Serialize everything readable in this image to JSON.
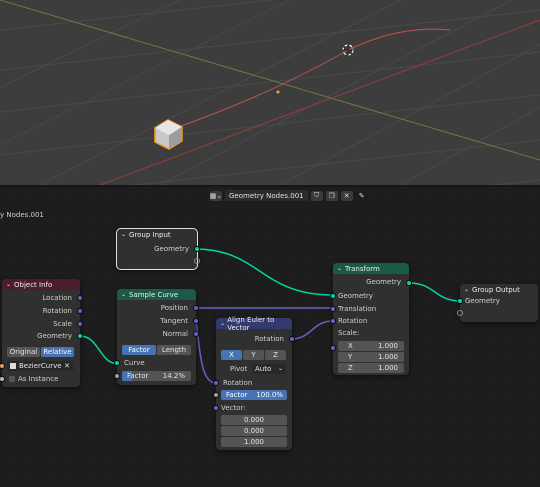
{
  "editor": {
    "tree_name": "Geometry Nodes.001",
    "breadcrumb": "y Nodes.001"
  },
  "nodes": {
    "group_input": {
      "title": "Group Input",
      "geometry": "Geometry"
    },
    "object_info": {
      "title": "Object Info",
      "location": "Location",
      "rotation": "Rotation",
      "scale": "Scale",
      "geometry": "Geometry",
      "mode_original": "Original",
      "mode_relative": "Relative",
      "object": "BezierCurve",
      "as_instance": "As Instance"
    },
    "sample_curve": {
      "title": "Sample Curve",
      "position": "Position",
      "tangent": "Tangent",
      "normal": "Normal",
      "mode_factor": "Factor",
      "mode_length": "Length",
      "curve": "Curve",
      "factor_label": "Factor",
      "factor_value": "14.2%"
    },
    "align_euler": {
      "title": "Align Euler to Vector",
      "rotation_out": "Rotation",
      "axis_x": "X",
      "axis_y": "Y",
      "axis_z": "Z",
      "pivot_label": "Pivot",
      "pivot_value": "Auto",
      "rotation_in": "Rotation",
      "factor_label": "Factor",
      "factor_value": "100.0%",
      "vector_label": "Vector:",
      "vec_x": "0.000",
      "vec_y": "0.000",
      "vec_z": "1.000"
    },
    "transform": {
      "title": "Transform",
      "geometry_out": "Geometry",
      "geometry_in": "Geometry",
      "translation": "Translation",
      "rotation": "Rotation",
      "scale_label": "Scale:",
      "sx_label": "X",
      "sx": "1.000",
      "sy_label": "Y",
      "sy": "1.000",
      "sz_label": "Z",
      "sz": "1.000"
    },
    "group_output": {
      "title": "Group Output",
      "geometry": "Geometry"
    }
  },
  "colors": {
    "geometry_socket": "#00d6a3",
    "vector_socket": "#6363c7",
    "float_socket": "#a1a1a1",
    "object_socket": "#ed9e5c",
    "input_header": "#4c1e2a",
    "geometry_header": "#1a5a49",
    "vector_header": "#333a6e",
    "active_button": "#4772b3",
    "selection_outline": "#ff9a1f"
  }
}
